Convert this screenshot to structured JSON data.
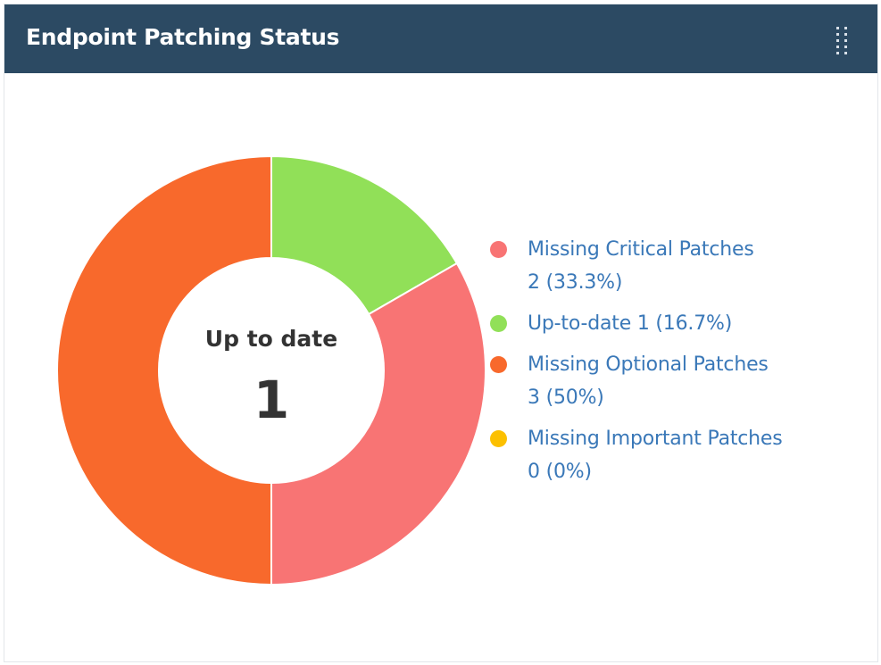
{
  "widget": {
    "title": "Endpoint Patching Status",
    "menu_icon": "drag-handle-dots-icon"
  },
  "colors": {
    "header_bg": "#2c4a63",
    "critical": "#f87474",
    "uptodate": "#91e058",
    "optional": "#f8692c",
    "important": "#fcc000",
    "legend_text": "#3a78b8"
  },
  "center": {
    "label": "Up to date",
    "value": "1"
  },
  "legend": [
    {
      "key": "critical",
      "line1": "Missing Critical Patches",
      "line2": "2 (33.3%)"
    },
    {
      "key": "uptodate",
      "line1": "Up-to-date 1 (16.7%)",
      "line2": ""
    },
    {
      "key": "optional",
      "line1": "Missing Optional Patches",
      "line2": "3 (50%)"
    },
    {
      "key": "important",
      "line1": "Missing Important Patches",
      "line2": "0 (0%)"
    }
  ],
  "chart_data": {
    "type": "pie",
    "donut": true,
    "title": "Endpoint Patching Status",
    "center_text": "Up to date",
    "center_value": 1,
    "slices": [
      {
        "label": "Up-to-date",
        "value": 1,
        "percent": 16.7,
        "color": "#91e058"
      },
      {
        "label": "Missing Critical Patches",
        "value": 2,
        "percent": 33.3,
        "color": "#f87474"
      },
      {
        "label": "Missing Optional Patches",
        "value": 3,
        "percent": 50,
        "color": "#f8692c"
      },
      {
        "label": "Missing Important Patches",
        "value": 0,
        "percent": 0,
        "color": "#fcc000"
      }
    ],
    "legend_position": "right"
  }
}
